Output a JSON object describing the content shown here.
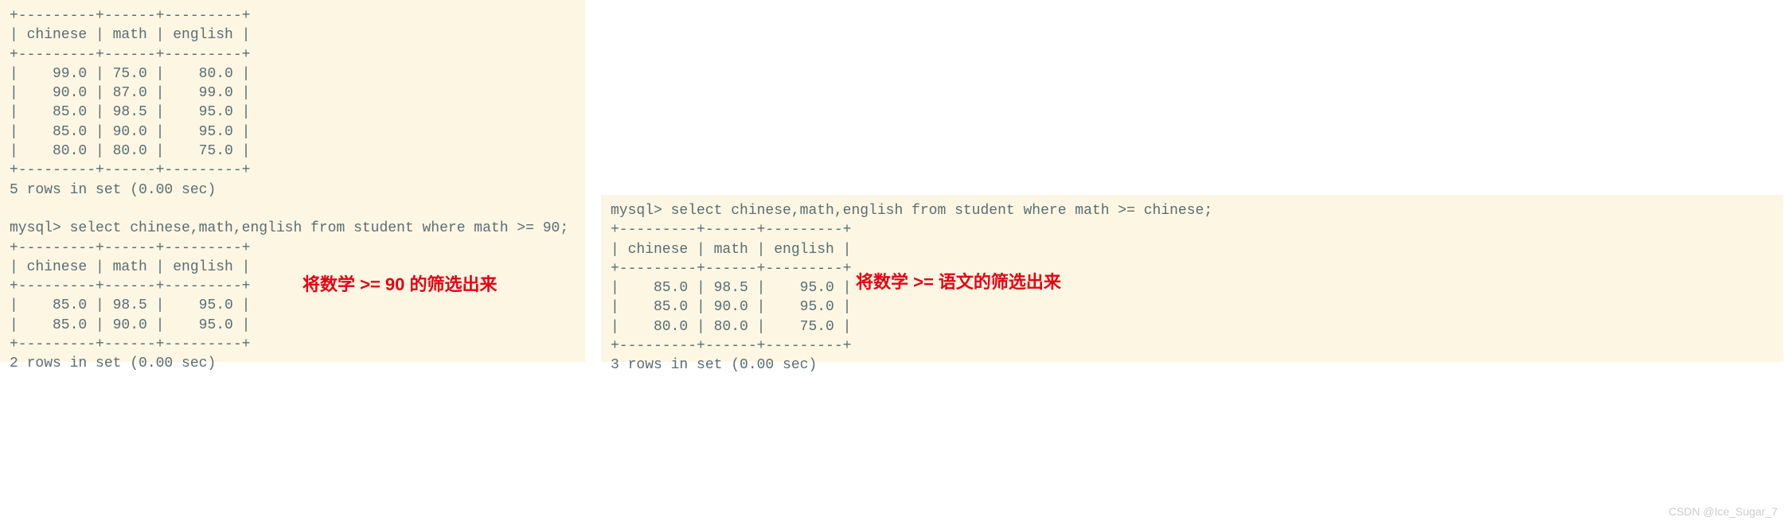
{
  "left": {
    "border_top": "+---------+------+---------+",
    "header": "| chinese | math | english |",
    "border_mid": "+---------+------+---------+",
    "row1": "|    99.0 | 75.0 |    80.0 |",
    "row2": "|    90.0 | 87.0 |    99.0 |",
    "row3": "|    85.0 | 98.5 |    95.0 |",
    "row4": "|    85.0 | 90.0 |    95.0 |",
    "row5": "|    80.0 | 80.0 |    75.0 |",
    "border_bot": "+---------+------+---------+",
    "summary1": "5 rows in set (0.00 sec)",
    "blank1": "",
    "query": "mysql> select chinese,math,english from student where math >= 90;",
    "q_border_top": "+---------+------+---------+",
    "q_header": "| chinese | math | english |",
    "q_border_mid": "+---------+------+---------+",
    "q_row1": "|    85.0 | 98.5 |    95.0 |",
    "q_row2": "|    85.0 | 90.0 |    95.0 |",
    "q_border_bot": "+---------+------+---------+",
    "q_summary": "2 rows in set (0.00 sec)"
  },
  "right": {
    "query": "mysql> select chinese,math,english from student where math >= chinese;",
    "border_top": "+---------+------+---------+",
    "header": "| chinese | math | english |",
    "border_mid": "+---------+------+---------+",
    "row1": "|    85.0 | 98.5 |    95.0 |",
    "row2": "|    85.0 | 90.0 |    95.0 |",
    "row3": "|    80.0 | 80.0 |    75.0 |",
    "border_bot": "+---------+------+---------+",
    "summary": "3 rows in set (0.00 sec)"
  },
  "annotation": {
    "left": "将数学 >= 90 的筛选出来",
    "right": "将数学 >= 语文的筛选出来"
  },
  "watermark": "CSDN @Ice_Sugar_7",
  "chart_data": [
    {
      "type": "table",
      "title": "student (full)",
      "columns": [
        "chinese",
        "math",
        "english"
      ],
      "rows": [
        [
          99.0,
          75.0,
          80.0
        ],
        [
          90.0,
          87.0,
          99.0
        ],
        [
          85.0,
          98.5,
          95.0
        ],
        [
          85.0,
          90.0,
          95.0
        ],
        [
          80.0,
          80.0,
          75.0
        ]
      ]
    },
    {
      "type": "table",
      "title": "where math >= 90",
      "columns": [
        "chinese",
        "math",
        "english"
      ],
      "rows": [
        [
          85.0,
          98.5,
          95.0
        ],
        [
          85.0,
          90.0,
          95.0
        ]
      ]
    },
    {
      "type": "table",
      "title": "where math >= chinese",
      "columns": [
        "chinese",
        "math",
        "english"
      ],
      "rows": [
        [
          85.0,
          98.5,
          95.0
        ],
        [
          85.0,
          90.0,
          95.0
        ],
        [
          80.0,
          80.0,
          75.0
        ]
      ]
    }
  ]
}
